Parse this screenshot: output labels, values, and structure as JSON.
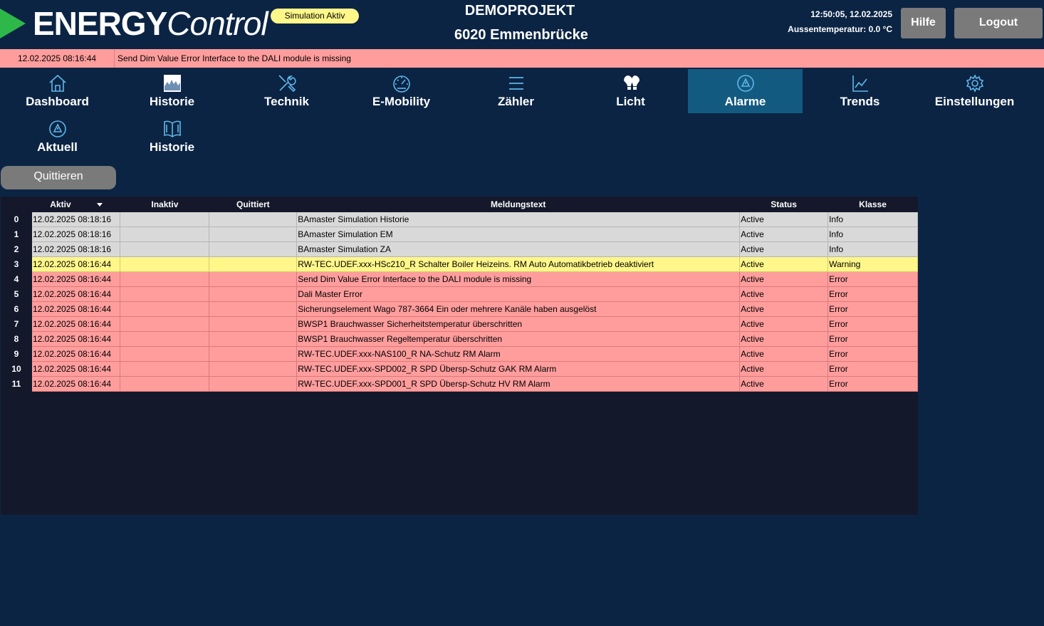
{
  "header": {
    "logo_bold": "ENERGY",
    "logo_light": "Control",
    "simulation_badge": "Simulation Aktiv",
    "project_title": "DEMOPROJEKT",
    "project_location": "6020 Emmenbrücke",
    "clock": "12:50:05, 12.02.2025",
    "temperature": "Aussentemperatur: 0.0 °C",
    "help_label": "Hilfe",
    "logout_label": "Logout",
    "accent_color": "#2fb84a"
  },
  "alert_banner": {
    "timestamp": "12.02.2025 08:16:44",
    "message": "Send Dim Value Error  Interface to the DALI module is missing",
    "color": "#ff9d9d"
  },
  "nav": {
    "active": "Alarme",
    "items": [
      {
        "label": "Dashboard",
        "icon": "home-icon"
      },
      {
        "label": "Historie",
        "icon": "history-chart-icon"
      },
      {
        "label": "Technik",
        "icon": "tools-icon"
      },
      {
        "label": "E-Mobility",
        "icon": "gauge-icon"
      },
      {
        "label": "Zähler",
        "icon": "menu-icon"
      },
      {
        "label": "Licht",
        "icon": "bulb-icon"
      },
      {
        "label": "Alarme",
        "icon": "alarm-icon"
      },
      {
        "label": "Trends",
        "icon": "trend-chart-icon"
      },
      {
        "label": "Einstellungen",
        "icon": "gear-icon"
      }
    ]
  },
  "subnav": {
    "items": [
      {
        "label": "Aktuell",
        "icon": "alarm-icon"
      },
      {
        "label": "Historie",
        "icon": "book-icon"
      }
    ]
  },
  "actions": {
    "quit_label": "Quittieren"
  },
  "table": {
    "columns": [
      "Aktiv",
      "Inaktiv",
      "Quittiert",
      "Meldungstext",
      "Status",
      "Klasse"
    ],
    "sorted_column": "Aktiv",
    "rows": [
      {
        "idx": "0",
        "active": "12.02.2025 08:18:16",
        "inactive": "",
        "acknowledged": "",
        "text": "BAmaster  Simulation Historie",
        "status": "Active",
        "class": "Info"
      },
      {
        "idx": "1",
        "active": "12.02.2025 08:18:16",
        "inactive": "",
        "acknowledged": "",
        "text": "BAmaster  Simulation EM",
        "status": "Active",
        "class": "Info"
      },
      {
        "idx": "2",
        "active": "12.02.2025 08:18:16",
        "inactive": "",
        "acknowledged": "",
        "text": "BAmaster  Simulation ZA",
        "status": "Active",
        "class": "Info"
      },
      {
        "idx": "3",
        "active": "12.02.2025 08:16:44",
        "inactive": "",
        "acknowledged": "",
        "text": "RW-TEC.UDEF.xxx-HSc210_R Schalter Boiler Heizeins. RM Auto  Automatikbetrieb deaktiviert",
        "status": "Active",
        "class": "Warning"
      },
      {
        "idx": "4",
        "active": "12.02.2025 08:16:44",
        "inactive": "",
        "acknowledged": "",
        "text": " Send Dim Value Error  Interface to the DALI module is missing",
        "status": "Active",
        "class": "Error"
      },
      {
        "idx": "5",
        "active": "12.02.2025 08:16:44",
        "inactive": "",
        "acknowledged": "",
        "text": " Dali Master Error",
        "status": "Active",
        "class": "Error"
      },
      {
        "idx": "6",
        "active": "12.02.2025 08:16:44",
        "inactive": "",
        "acknowledged": "",
        "text": "Sicherungselement Wago 787-3664 Ein oder mehrere Kanäle haben ausgelöst",
        "status": "Active",
        "class": "Error"
      },
      {
        "idx": "7",
        "active": "12.02.2025 08:16:44",
        "inactive": "",
        "acknowledged": "",
        "text": "BWSP1 Brauchwasser Sicherheitstemperatur überschritten",
        "status": "Active",
        "class": "Error"
      },
      {
        "idx": "8",
        "active": "12.02.2025 08:16:44",
        "inactive": "",
        "acknowledged": "",
        "text": "BWSP1 Brauchwasser Regeltemperatur überschritten",
        "status": "Active",
        "class": "Error"
      },
      {
        "idx": "9",
        "active": "12.02.2025 08:16:44",
        "inactive": "",
        "acknowledged": "",
        "text": "RW-TEC.UDEF.xxx-NAS100_R NA-Schutz RM Alarm",
        "status": "Active",
        "class": "Error"
      },
      {
        "idx": "10",
        "active": "12.02.2025 08:16:44",
        "inactive": "",
        "acknowledged": "",
        "text": "RW-TEC.UDEF.xxx-SPD002_R SPD Übersp-Schutz GAK RM Alarm",
        "status": "Active",
        "class": "Error"
      },
      {
        "idx": "11",
        "active": "12.02.2025 08:16:44",
        "inactive": "",
        "acknowledged": "",
        "text": "RW-TEC.UDEF.xxx-SPD001_R SPD Übersp-Schutz HV RM Alarm",
        "status": "Active",
        "class": "Error"
      }
    ],
    "class_colors": {
      "Info": "#d9d9d9",
      "Warning": "#fff78a",
      "Error": "#ff9d9d"
    }
  }
}
